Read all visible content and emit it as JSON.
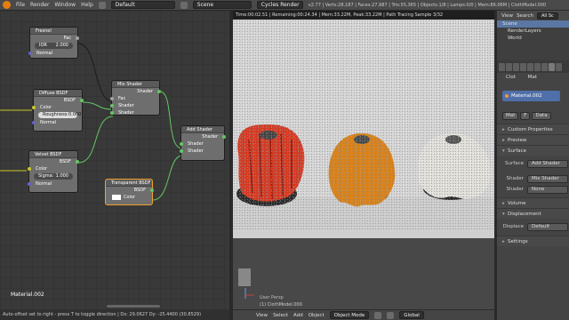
{
  "topbar": {
    "menus": [
      "File",
      "Render",
      "Window",
      "Help"
    ],
    "screen_layout": "Default",
    "scene": "Scene",
    "engine": "Cycles Render",
    "stats": "v2.77 | Verts:28,187 | Faces:27,987 | Tris:55,365 | Objects:1/8 | Lamps:0/0 | Mem:86.06M | ClothModel.000"
  },
  "node_editor": {
    "nodes": {
      "fresnel": {
        "title": "Fresnel",
        "out": "Fac",
        "ior_label": "IOR",
        "ior_value": "2.000",
        "normal": "Normal"
      },
      "diffuse": {
        "title": "Diffuse BSDF",
        "out": "BSDF",
        "color": "Color",
        "roughness_label": "Roughness:",
        "roughness_value": "0.000",
        "normal": "Normal"
      },
      "velvet": {
        "title": "Velvet BSDF",
        "out": "BSDF",
        "color": "Color",
        "sigma_label": "Sigma:",
        "sigma_value": "1.000",
        "normal": "Normal"
      },
      "mix": {
        "title": "Mix Shader",
        "out": "Shader",
        "fac": "Fac",
        "shader1": "Shader",
        "shader2": "Shader"
      },
      "add": {
        "title": "Add Shader",
        "out": "Shader",
        "shader1": "Shader",
        "shader2": "Shader"
      },
      "transparent": {
        "title": "Transparent BSDF",
        "out": "BSDF",
        "color": "Color"
      }
    },
    "material_name": "Material.002",
    "status": "Auto-offset set to right - press T to toggle direction | Dx: 29.0627  Dy: -25.4400 (30.8529)"
  },
  "viewport": {
    "render_info": "Time:00:02.51 | Remaining:00:24.34 | Mem:33.22M, Peak:33.22M | Path Tracing Sample 3/32",
    "view_label": "User Persp",
    "object_label": "(1) ClothModel.000",
    "menu": [
      "View",
      "Select",
      "Add",
      "Object"
    ],
    "mode": "Object Mode",
    "orientation": "Global"
  },
  "outliner": {
    "menu": [
      "View",
      "Search"
    ],
    "filter": "All Sc",
    "items": [
      "Scene",
      "RenderLayers",
      "World"
    ]
  },
  "properties": {
    "breadcrumb": [
      "Clot",
      "Mat"
    ],
    "material_slot": "Material.002",
    "buttons": [
      "Mat",
      "F",
      "Data"
    ],
    "panels": {
      "custom_properties": "Custom Properties",
      "preview": "Preview",
      "surface": "Surface",
      "volume": "Volume",
      "displacement": "Displacement",
      "settings": "Settings"
    },
    "surface_label": "Surface",
    "surface_value": "Add Shader",
    "shader_label": "Shader",
    "shader_value": "Mix Shader",
    "shader2_label": "Shader",
    "shader2_value": "None",
    "displace_label": "Displace",
    "displace_value": "Default"
  },
  "colors": {
    "red_cloth": "#d63a22",
    "orange_cloth": "#d9821a",
    "white_cloth": "#e4e2dc",
    "accent": "#e87d0d",
    "selection_blue": "#4f6fa8"
  }
}
